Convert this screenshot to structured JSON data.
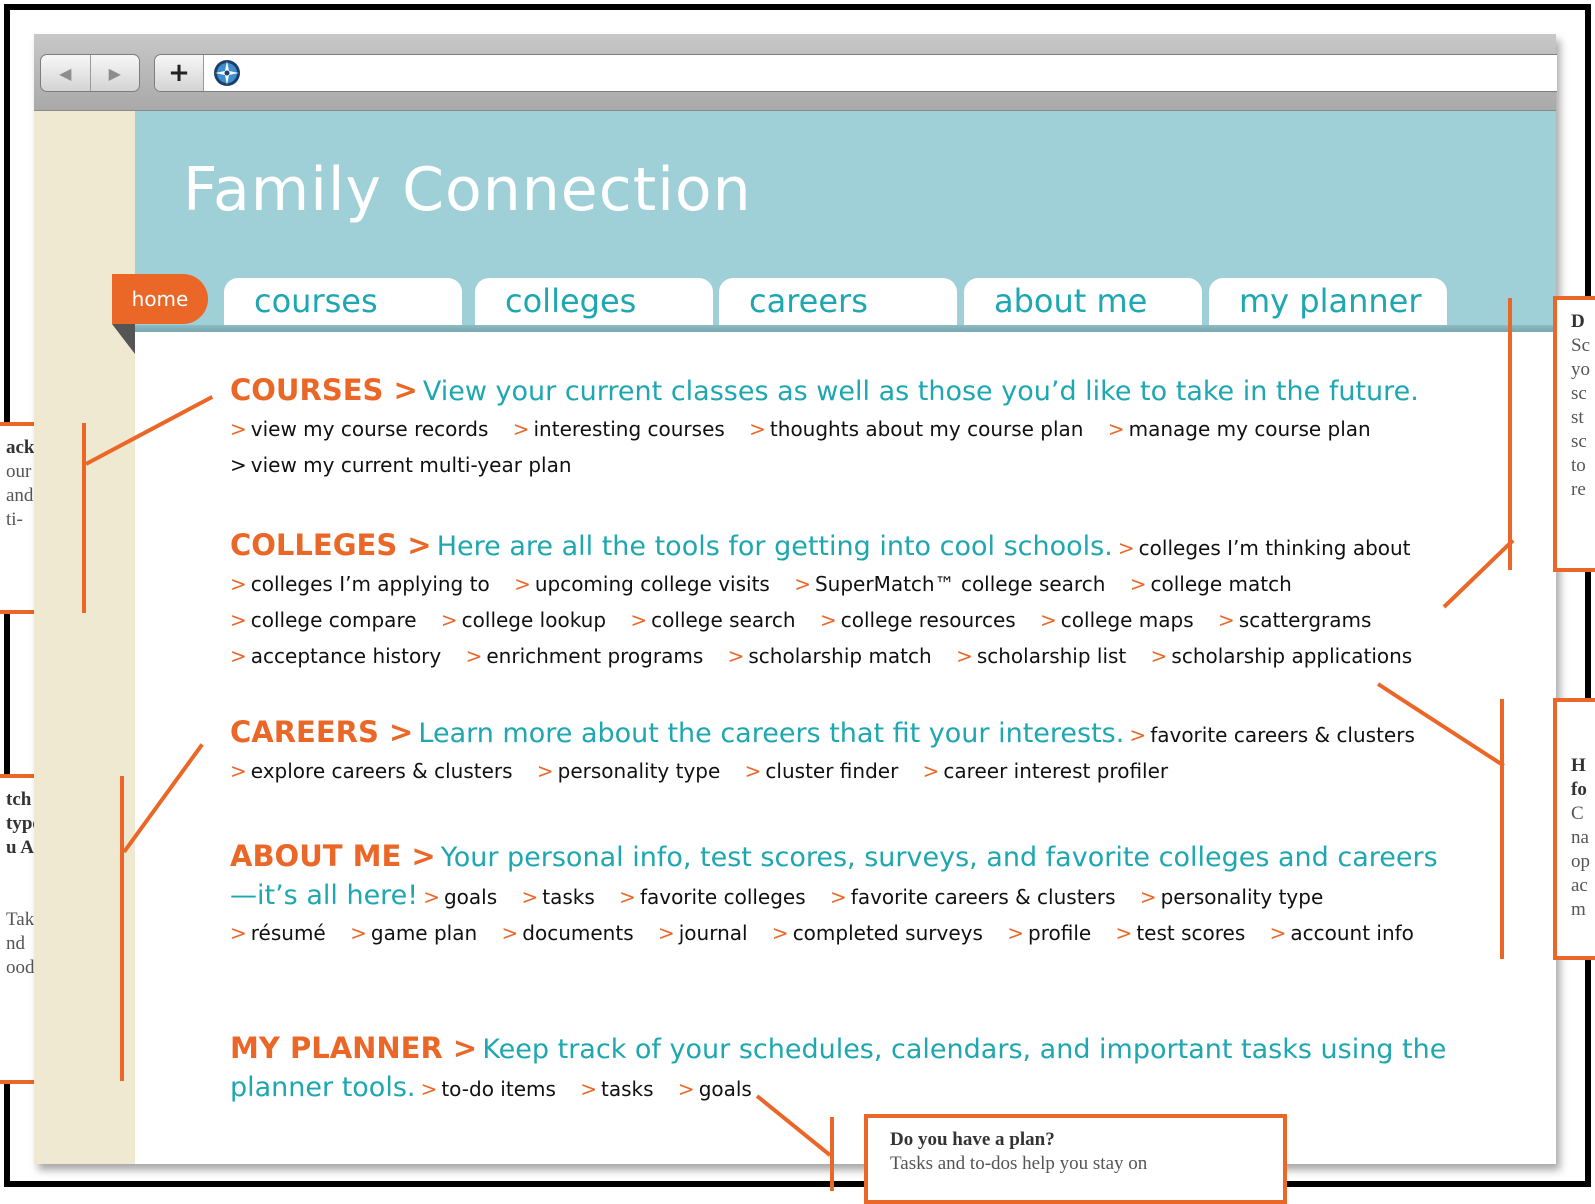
{
  "browser": {
    "back_arrow": "◀",
    "forward_arrow": "▶",
    "new_tab_symbol": "+"
  },
  "site": {
    "title": "Family Connection",
    "home_tab": "home",
    "tabs": [
      "courses",
      "colleges",
      "careers",
      "about me",
      "my planner"
    ]
  },
  "sections": {
    "courses": {
      "title": "COURSES >",
      "tagline": "View your current classes as well as those you’d like to take in the future.",
      "links": [
        "view my course records",
        "interesting courses",
        "thoughts about my course plan",
        "manage my course plan",
        "view my current multi-year plan"
      ]
    },
    "colleges": {
      "title": "COLLEGES >",
      "tagline": "Here are all the tools for getting into cool schools.",
      "links": [
        "colleges I’m thinking about",
        "colleges I’m applying to",
        "upcoming college visits",
        "SuperMatch™ college search",
        "college match",
        "college compare",
        "college lookup",
        "college search",
        "college resources",
        "college maps",
        "scattergrams",
        "acceptance history",
        "enrichment programs",
        "scholarship match",
        "scholarship list",
        "scholarship applications"
      ]
    },
    "careers": {
      "title": "CAREERS >",
      "tagline": "Learn more about the careers that fit your interests.",
      "links": [
        "favorite careers & clusters",
        "explore careers & clusters",
        "personality type",
        "cluster finder",
        "career interest profiler"
      ]
    },
    "about_me": {
      "title": "ABOUT ME >",
      "tagline": "Your personal info, test scores, surveys, and favorite colleges and careers—it’s all here!",
      "links": [
        "goals",
        "tasks",
        "favorite colleges",
        "favorite careers & clusters",
        "personality type",
        "résumé",
        "game plan",
        "documents",
        "journal",
        "completed surveys",
        "profile",
        "test scores",
        "account info"
      ]
    },
    "planner": {
      "title": "MY PLANNER >",
      "tagline": "Keep track of your schedules, calendars, and important tasks using the planner tools.",
      "links": [
        "to-do items",
        "tasks",
        "goals"
      ]
    }
  },
  "link_prefix": ">",
  "callouts": {
    "left_top": {
      "heading": "ack?",
      "lines": [
        "our",
        "and",
        "ti-"
      ]
    },
    "left_mid": {
      "heading_lines": [
        "tch",
        "type?",
        "u Are"
      ],
      "lines": [
        "Take the",
        "nd",
        "ood"
      ]
    },
    "right_top": {
      "heading": "D",
      "lines": [
        "Sc",
        "yo",
        "sc",
        "st",
        "sc",
        "to",
        "re"
      ]
    },
    "right_mid": {
      "heading_lines": [
        "H",
        "fo"
      ],
      "lines": [
        "C",
        "na",
        "op",
        "ac",
        "m"
      ]
    },
    "bottom": {
      "heading": "Do you have a plan?",
      "line": "Tasks and to-dos help you stay on"
    }
  },
  "colors": {
    "accent_orange": "#ea6727",
    "teal_text": "#1ea7b0",
    "header_blue": "#9fcfd7",
    "sidebar_beige": "#f0e9d2"
  }
}
